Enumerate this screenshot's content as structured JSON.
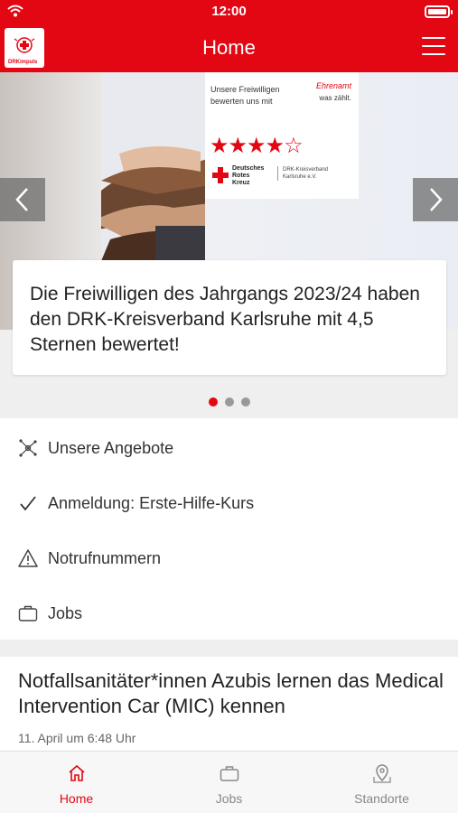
{
  "status_bar": {
    "time": "12:00"
  },
  "header": {
    "title": "Home",
    "logo_text": "DRKimpuls"
  },
  "carousel": {
    "promo_text_line1": "Unsere Freiwilligen",
    "promo_text_line2": "bewerten uns mit",
    "promo_signature": "Ehrenamt",
    "promo_signature_sub": "was zählt.",
    "stars_rating": 4.5,
    "stars_display": "★★★★☆",
    "drk_line1": "Deutsches",
    "drk_line2": "Rotes",
    "drk_line3": "Kreuz",
    "kv_line1": "DRK-Kreisverband",
    "kv_line2": "Karlsruhe e.V.",
    "headline": "Die Freiwilligen des Jahrgangs 2023/24 haben den DRK-Kreisverband Karlsruhe mit 4,5 Sternen bewertet!",
    "page_count": 3,
    "active_page": 1
  },
  "menu": {
    "items": [
      {
        "label": "Unsere Angebote",
        "icon": "network-icon"
      },
      {
        "label": "Anmeldung: Erste-Hilfe-Kurs",
        "icon": "checkmark-icon"
      },
      {
        "label": "Notrufnummern",
        "icon": "warning-icon"
      },
      {
        "label": "Jobs",
        "icon": "briefcase-icon"
      }
    ]
  },
  "news": {
    "headline": "Notfallsanitäter*innen Azubis lernen das Medical Intervention Car (MIC) kennen",
    "date": "11. April um 6:48 Uhr"
  },
  "tabs": [
    {
      "label": "Home",
      "icon": "home-icon",
      "active": true
    },
    {
      "label": "Jobs",
      "icon": "briefcase-icon",
      "active": false
    },
    {
      "label": "Standorte",
      "icon": "map-pin-icon",
      "active": false
    }
  ],
  "colors": {
    "brand_red": "#e30613",
    "text": "#222222",
    "muted": "#888888"
  }
}
